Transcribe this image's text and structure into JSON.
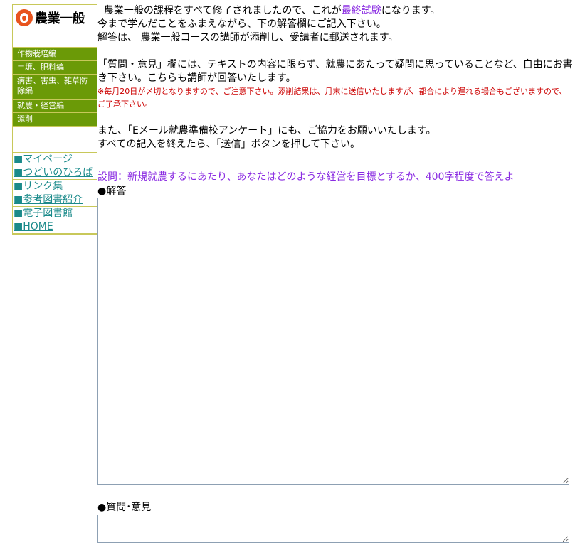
{
  "sidebar": {
    "logo_text": "農業一般",
    "menu": [
      {
        "label": "作物栽培編"
      },
      {
        "label": "土壌、肥料編"
      },
      {
        "label": "病害、害虫、雑草防除編"
      },
      {
        "label": "就農・経営編"
      },
      {
        "label": "添削"
      }
    ],
    "links": [
      {
        "label": "マイページ"
      },
      {
        "label": "つどいのひろば"
      },
      {
        "label": "リンク集"
      },
      {
        "label": "参考図書紹介"
      },
      {
        "label": "電子図書館"
      },
      {
        "label": "HOME"
      }
    ],
    "square": "■"
  },
  "main": {
    "intro_line1_a": "農業一般の課程をすべて修了されましたので、これが",
    "intro_line1_link": "最終試験",
    "intro_line1_b": "になります。",
    "intro_line2": "今まで学んだことをふまえながら、下の解答欄にご記入下さい。",
    "intro_line3": "解答は、 農業一般コースの講師が添削し、受講者に郵送されます。",
    "qa_para": "「質問・意見」欄には、テキストの内容に限らず、就農にあたって疑問に思っていることなど、自由にお書き下さい。こちらも講師が回答いたします。",
    "notice": "※毎月20日が〆切となりますので、ご注意下さい。添削結果は、月末に送信いたしますが、都合により遅れる場合もございますので、ご了承下さい。",
    "survey_line1": "また、「Eメール就農準備校アンケート」にも、ご協力をお願いいたします。",
    "survey_line2": "すべての記入を終えたら、「送信」ボタンを押して下さい。",
    "question": "設問：新規就農するにあたり、あなたはどのような経営を目標とするか、400字程度で答えよ",
    "answer_label": "●解答",
    "qa_label": "●質問･意見"
  }
}
